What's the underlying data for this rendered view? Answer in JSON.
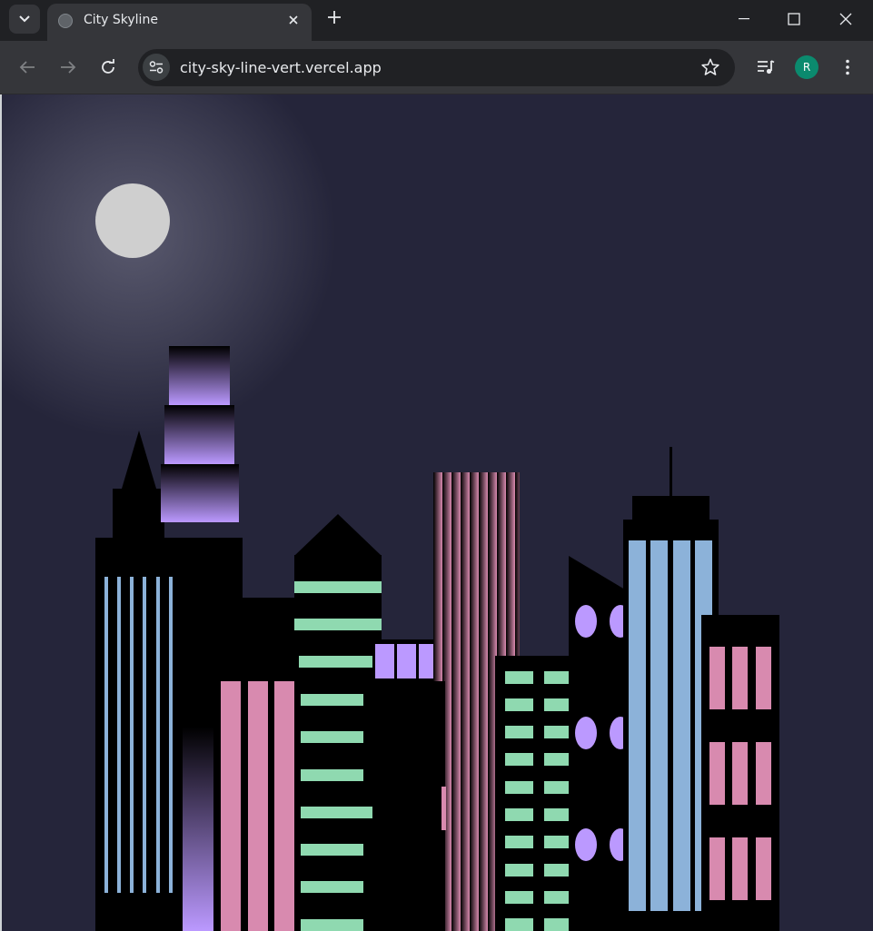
{
  "browser": {
    "tab_title": "City Skyline",
    "url": "city-sky-line-vert.vercel.app",
    "profile_initial": "R",
    "colors": {
      "frame": "#202124",
      "toolbar": "#35363a",
      "profile": "#0b8a6e"
    }
  },
  "page": {
    "colors": {
      "sky": "#25253a",
      "building": "#000000",
      "window_blue": "#8cb2d9",
      "window_pink": "#d88aaf",
      "window_green": "#8fd9b0",
      "window_purple": "#bb99ff",
      "moon": "#cfcfcf"
    }
  }
}
